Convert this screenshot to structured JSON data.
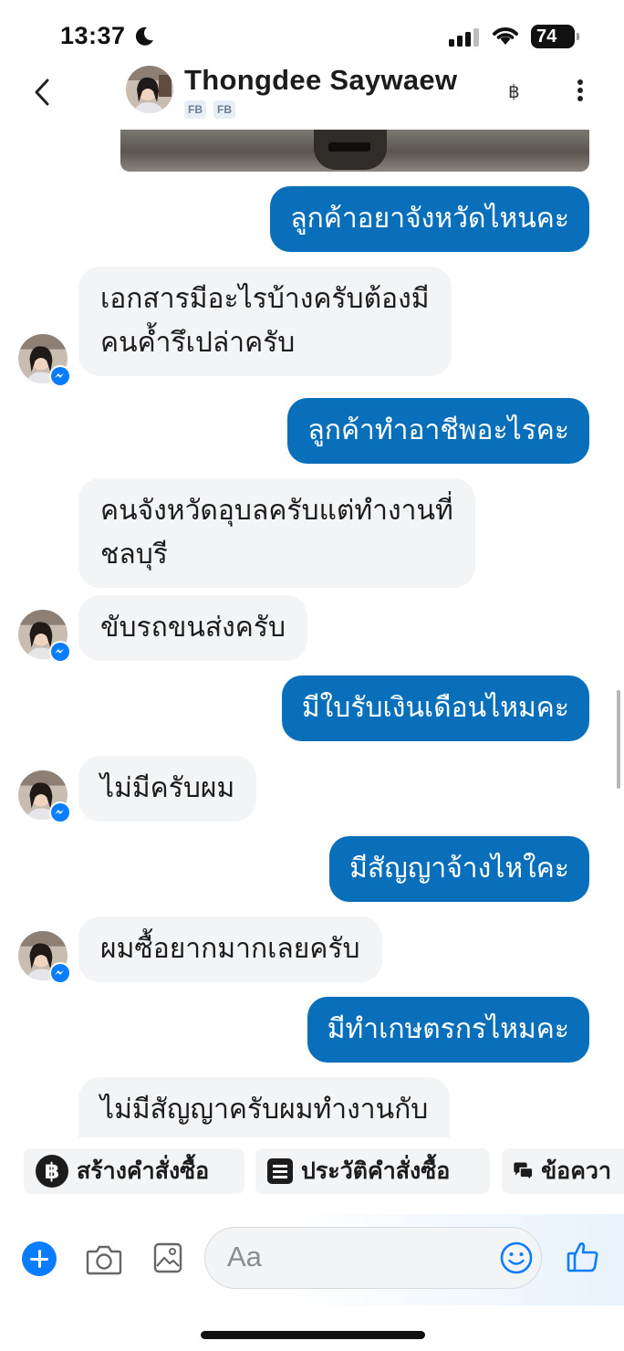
{
  "status": {
    "time": "13:37",
    "battery": "74"
  },
  "header": {
    "contact_name": "Thongdee Saywaew",
    "badges": [
      "FB",
      "FB"
    ],
    "currency_symbol": "฿"
  },
  "messages": [
    {
      "side": "outgoing",
      "text": "ลูกค้าอยาจังหวัดไหนคะ"
    },
    {
      "side": "incoming",
      "lines": [
        "เอกสารมีอะไรบ้างครับต้องมี",
        "คนค้ำรึเปล่าครับ"
      ]
    },
    {
      "side": "outgoing",
      "text": "ลูกค้าทำอาชีพอะไรคะ"
    },
    {
      "side": "incoming",
      "lines": [
        "คนจังหวัดอุบลครับแต่ทำงานที่",
        "ชลบุรี"
      ]
    },
    {
      "side": "incoming",
      "text": "ขับรถขนส่งครับ"
    },
    {
      "side": "outgoing",
      "text": "มีใบรับเงินเดือนไหมคะ"
    },
    {
      "side": "incoming",
      "text": "ไม่มีครับผม"
    },
    {
      "side": "outgoing",
      "text": "มีสัญญาจ้างไหใคะ"
    },
    {
      "side": "incoming",
      "text": "ผมซื้อยากมากเลยครับ"
    },
    {
      "side": "outgoing",
      "text": "มีทำเกษตรกรไหมคะ"
    },
    {
      "side": "incoming",
      "text": "ไม่มีสัญญาครับผมทำงานกับ"
    }
  ],
  "quick_actions": [
    {
      "label": "สร้างคำสั่งซื้อ",
      "icon": "baht-circle-icon"
    },
    {
      "label": "ประวัติคำสั่งซื้อ",
      "icon": "order-list-icon"
    },
    {
      "label": "ข้อควา",
      "icon": "chat-bubbles-icon"
    }
  ],
  "composer": {
    "placeholder": "Aa"
  },
  "colors": {
    "outgoing_bubble": "#0a6fbb",
    "incoming_bubble": "#f3f4f6",
    "messenger_blue": "#0a7cff"
  }
}
